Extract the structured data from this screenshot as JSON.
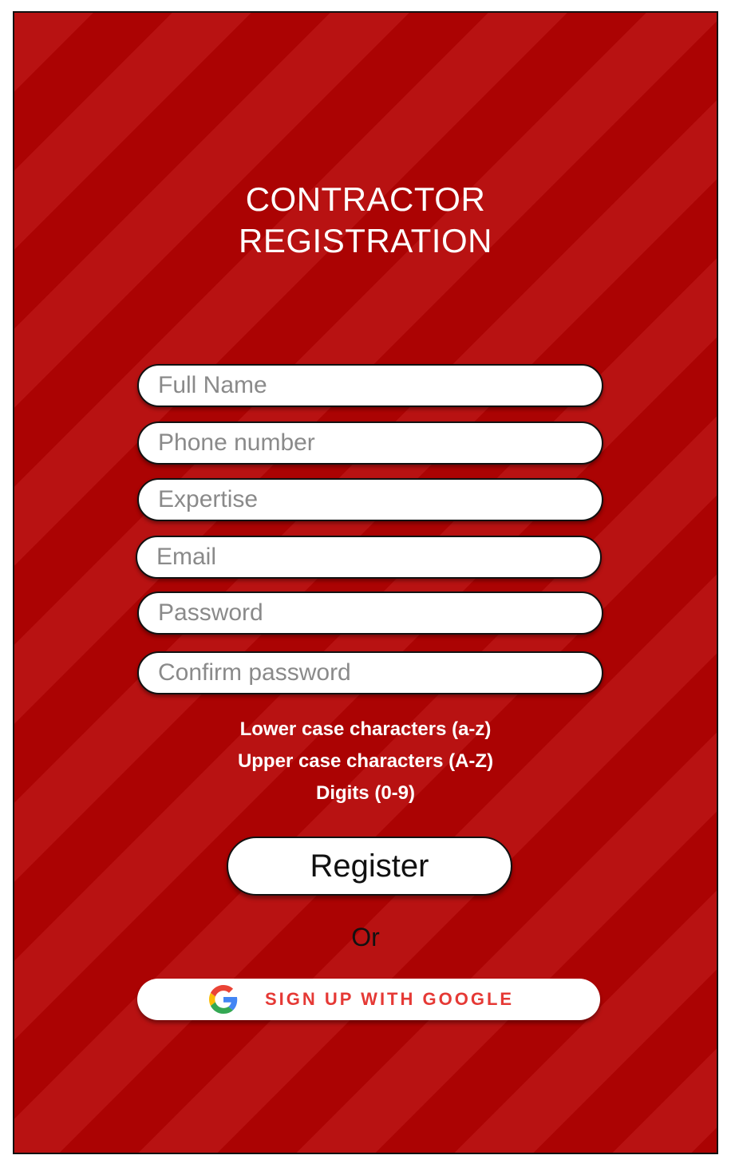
{
  "title": {
    "line1": "CONTRACTOR",
    "line2": "REGISTRATION"
  },
  "form": {
    "fields": [
      {
        "placeholder": "Full Name",
        "value": ""
      },
      {
        "placeholder": "Phone number",
        "value": ""
      },
      {
        "placeholder": "Expertise",
        "value": ""
      },
      {
        "placeholder": "Email",
        "value": ""
      },
      {
        "placeholder": "Password",
        "value": ""
      },
      {
        "placeholder": "Confirm password",
        "value": ""
      }
    ],
    "password_rules": [
      "Lower case characters (a-z)",
      "Upper case characters (A-Z)",
      "Digits (0-9)"
    ],
    "register_label": "Register",
    "or_label": "Or",
    "google_label": "SIGN UP WITH GOOGLE"
  },
  "icons": {
    "google": "google-g-icon"
  },
  "colors": {
    "background": "#ad0505",
    "stripe": "#b81212",
    "google_text": "#e53935"
  }
}
